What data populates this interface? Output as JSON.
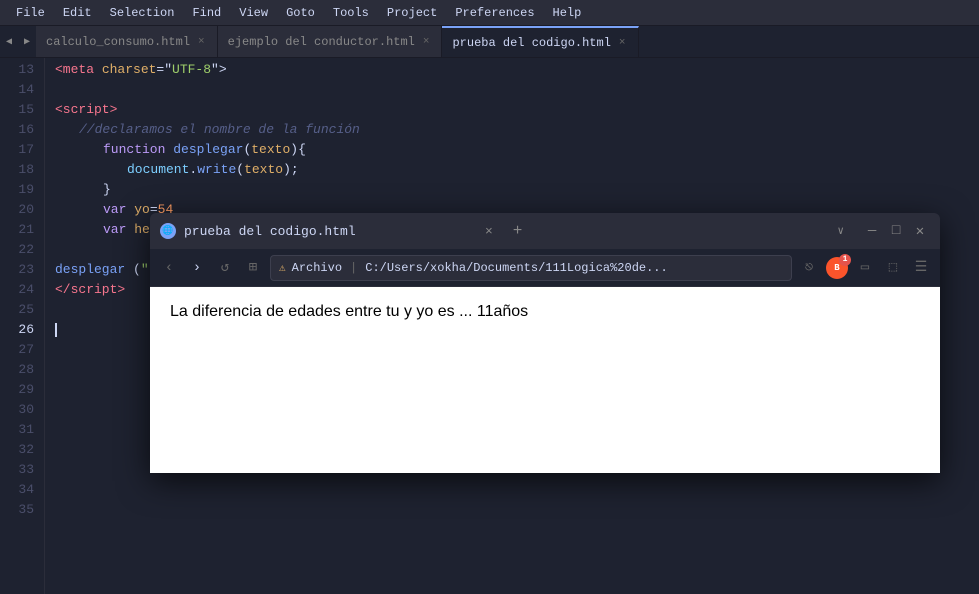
{
  "menubar": {
    "items": [
      "File",
      "Edit",
      "Selection",
      "Find",
      "View",
      "Goto",
      "Tools",
      "Project",
      "Preferences",
      "Help"
    ]
  },
  "tabs": [
    {
      "label": "calculo_consumo.html",
      "active": false,
      "id": "tab1"
    },
    {
      "label": "ejemplo del conductor.html",
      "active": false,
      "id": "tab2"
    },
    {
      "label": "prueba del codigo.html",
      "active": true,
      "id": "tab3"
    }
  ],
  "lineNumbers": [
    13,
    14,
    15,
    16,
    17,
    18,
    19,
    20,
    21,
    22,
    23,
    24,
    25,
    26,
    27,
    28,
    29,
    30,
    31,
    32,
    33,
    34,
    35
  ],
  "code": {
    "lines": [
      {
        "ln": 13,
        "content": "meta_charset"
      },
      {
        "ln": 14,
        "content": ""
      },
      {
        "ln": 15,
        "content": "script_open"
      },
      {
        "ln": 16,
        "content": "comment_declare"
      },
      {
        "ln": 17,
        "content": "function_def"
      },
      {
        "ln": 18,
        "content": "doc_write"
      },
      {
        "ln": 19,
        "content": "close_brace"
      },
      {
        "ln": 20,
        "content": "var_yo"
      },
      {
        "ln": 21,
        "content": "var_hermano"
      },
      {
        "ln": 22,
        "content": ""
      },
      {
        "ln": 23,
        "content": "desplegar_call"
      },
      {
        "ln": 24,
        "content": "script_close"
      },
      {
        "ln": 25,
        "content": ""
      },
      {
        "ln": 26,
        "content": "cursor"
      },
      {
        "ln": 27,
        "content": ""
      },
      {
        "ln": 28,
        "content": ""
      },
      {
        "ln": 29,
        "content": ""
      },
      {
        "ln": 30,
        "content": ""
      },
      {
        "ln": 31,
        "content": ""
      },
      {
        "ln": 32,
        "content": ""
      },
      {
        "ln": 33,
        "content": ""
      },
      {
        "ln": 34,
        "content": ""
      },
      {
        "ln": 35,
        "content": ""
      }
    ]
  },
  "browser": {
    "tab_title": "prueba del codigo.html",
    "tab_close": "×",
    "new_tab": "+",
    "address": "C:/Users/xokha/Documents/111Logica%20de...",
    "address_label": "Archivo",
    "content_text": "La diferencia de edades entre tu y yo es ... 11años",
    "win_min": "—",
    "win_max": "□",
    "win_close": "✕",
    "nav_back": "‹",
    "nav_fwd": "›",
    "nav_reload": "↺",
    "nav_bookmark": "🔖"
  }
}
